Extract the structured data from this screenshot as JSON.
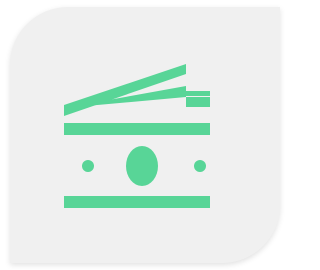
{
  "app_icon": {
    "name": "money-icon",
    "accent_color": "#58d597",
    "background_color": "#f0f0f0"
  }
}
